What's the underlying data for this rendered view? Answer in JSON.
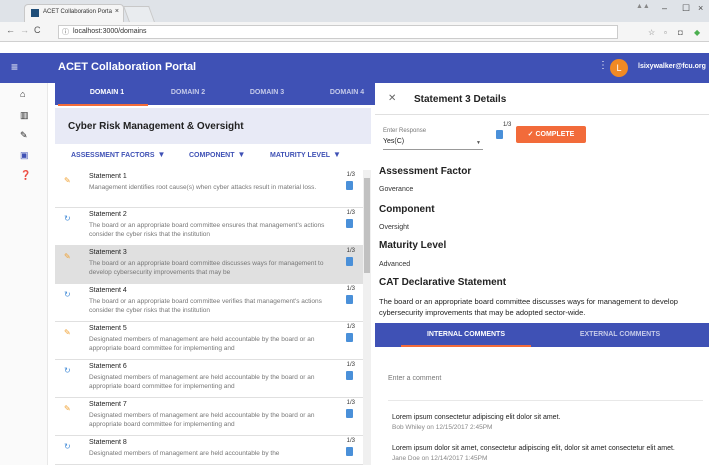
{
  "browser": {
    "tab_title": "ACET Collaboration Porta",
    "tab_close": "×",
    "url": "localhost:3000/domains",
    "window_min": "–",
    "window_max": "☐",
    "window_close": "×"
  },
  "app": {
    "title": "ACET Collaboration Portal",
    "avatar_letter": "L",
    "username": "lsixywalker@fcu.org",
    "brand_color": "#3f51b5",
    "accent_color": "#f26b3a"
  },
  "domain_tabs": [
    {
      "label": "DOMAIN 1",
      "active": true
    },
    {
      "label": "DOMAIN 2",
      "active": false
    },
    {
      "label": "DOMAIN 3",
      "active": false
    },
    {
      "label": "DOMAIN 4",
      "active": false
    }
  ],
  "section": {
    "title": "Cyber Risk Management & Oversight",
    "filters": [
      "ASSESSMENT FACTORS",
      "COMPONENT",
      "MATURITY LEVEL"
    ]
  },
  "statements": [
    {
      "name": "Statement 1",
      "desc": "Management identifies root cause(s) when cyber attacks result in material loss.",
      "count": "1/3",
      "status": "complete"
    },
    {
      "name": "Statement 2",
      "desc": "The board or an appropriate board committee ensures that management's actions consider the cyber risks that the institution",
      "count": "1/3",
      "status": "in-progress"
    },
    {
      "name": "Statement 3",
      "desc": "The board or an appropriate board committee discusses ways for management to develop cybersecurity improvements that may be",
      "count": "1/3",
      "status": "complete"
    },
    {
      "name": "Statement 4",
      "desc": "The board or an appropriate board committee verifies that management's actions consider the cyber risks that the institution",
      "count": "1/3",
      "status": "in-progress"
    },
    {
      "name": "Statement 5",
      "desc": "Designated members of management are held accountable by the board or an appropriate board committee for implementing and",
      "count": "1/3",
      "status": "complete"
    },
    {
      "name": "Statement 6",
      "desc": "Designated members of management are held accountable by the board or an appropriate board committee for implementing and",
      "count": "1/3",
      "status": "in-progress"
    },
    {
      "name": "Statement 7",
      "desc": "Designated members of management are held accountable by the board or an appropriate board committee for implementing and",
      "count": "1/3",
      "status": "complete"
    },
    {
      "name": "Statement 8",
      "desc": "Designated members of management are held accountable by the",
      "count": "1/3",
      "status": "in-progress"
    }
  ],
  "details": {
    "title": "Statement 3 Details",
    "response_label": "Enter Response",
    "response_value": "Yes(C)",
    "count": "1/3",
    "complete_label": "COMPLETE",
    "assessment_factor_label": "Assessment Factor",
    "assessment_factor_value": "Goverance",
    "component_label": "Component",
    "component_value": "Oversight",
    "maturity_label": "Maturity Level",
    "maturity_value": "Advanced",
    "declarative_label": "CAT Declarative Statement",
    "declarative_value": "The board or an appropriate board committee discusses ways for management to develop cybersecurity improvements that may be adopted sector-wide."
  },
  "comments": {
    "tabs": [
      "INTERNAL COMMENTS",
      "EXTERNAL COMMENTS"
    ],
    "placeholder": "Enter a comment",
    "items": [
      {
        "text": "Lorem ipsum consectetur adipiscing elit dolor sit amet.",
        "meta": "Bob Whiley on 12/15/2017 2:45PM"
      },
      {
        "text": "Lorem ipsum dolor sit amet, consectetur adipiscing elit, dolor sit amet consectetur elit amet.",
        "meta": "Jane Doe on 12/14/2017 1:45PM"
      }
    ]
  }
}
